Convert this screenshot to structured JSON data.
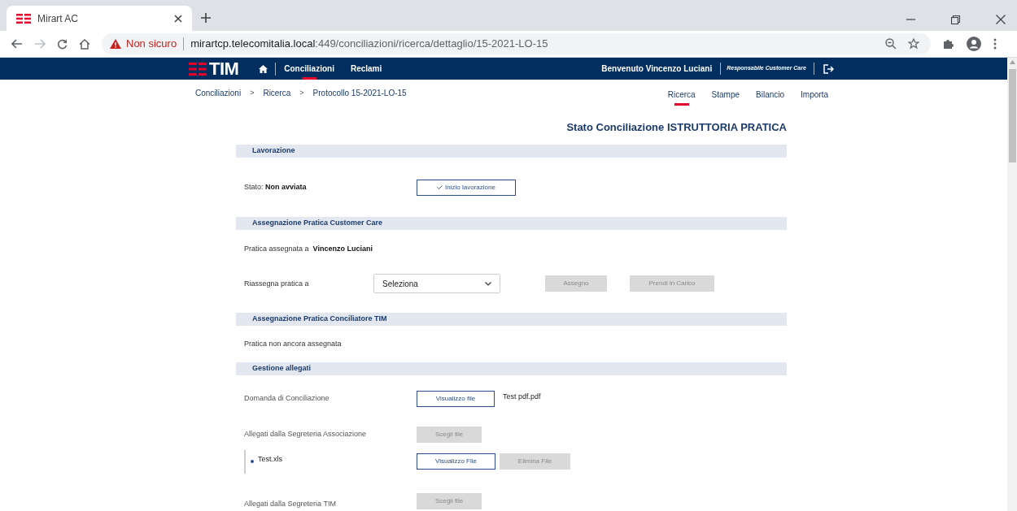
{
  "browser": {
    "tab_title": "Mirart AC",
    "security": "Non sicuro",
    "url_host": "mirartcp.telecomitalia.local",
    "url_rest": ":449/conciliazioni/ricerca/dettaglio/15-2021-LO-15"
  },
  "nav": {
    "logo": "TIM",
    "items": [
      {
        "label": "Conciliazioni",
        "selected": true
      },
      {
        "label": "Reclami",
        "selected": false
      }
    ],
    "welcome": "Benvenuto Vincenzo Luciani",
    "role": "Responsabile Customer Care"
  },
  "breadcrumbs": [
    "Conciliazioni",
    "Ricerca",
    "Protocollo 15-2021-LO-15"
  ],
  "breadcrumb_separator": ">",
  "subnav": [
    {
      "label": "Ricerca",
      "selected": true
    },
    {
      "label": "Stampe",
      "selected": false
    },
    {
      "label": "Bilancio",
      "selected": false
    },
    {
      "label": "Importa",
      "selected": false
    }
  ],
  "page_title": "Stato Conciliazione ISTRUTTORIA PRATICA",
  "sections": [
    {
      "title": "Lavorazione",
      "rows": [
        {
          "kind": "status",
          "label": "Stato:",
          "value": "Non avviata",
          "button": {
            "label": "Inizio lavorazione",
            "disabled": false
          }
        }
      ]
    },
    {
      "title": "Assegnazione Pratica Customer Care",
      "rows": [
        {
          "kind": "assigned",
          "label": "Pratica assegnata a",
          "value": "Vincenzo Luciani"
        },
        {
          "kind": "reassign",
          "label": "Riassegna pratica a",
          "select": "Seleziona",
          "buttons": [
            {
              "label": "Assegno",
              "disabled": true
            },
            {
              "label": "Prendi in Carico",
              "disabled": true
            }
          ]
        }
      ]
    },
    {
      "title": "Assegnazione Pratica Conciliatore TIM",
      "rows": [
        {
          "kind": "text",
          "label": "Pratica non ancora assegnata"
        }
      ]
    },
    {
      "title": "Gestione allegati",
      "rows": [
        {
          "kind": "file",
          "label": "Domanda di Conciliazione",
          "button": {
            "label": "Visualizzo file",
            "disabled": false
          },
          "filename": "Test pdf.pdf"
        },
        {
          "kind": "upload",
          "label": "Allegati dalla Segreteria Associazione",
          "button": {
            "label": "Scegli file",
            "disabled": true
          }
        },
        {
          "kind": "attachment",
          "label": "Test.xls",
          "buttons": [
            {
              "label": "Visualizzo File",
              "disabled": false
            },
            {
              "label": "Elimina File",
              "disabled": true
            }
          ]
        },
        {
          "kind": "upload_last",
          "label": "Allegati dalla Segreteria TIM",
          "button": {
            "label": "Scegli file",
            "disabled": true
          }
        }
      ]
    }
  ]
}
